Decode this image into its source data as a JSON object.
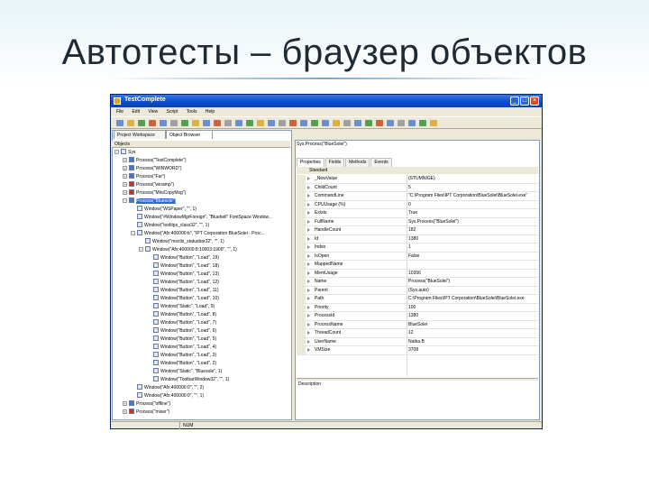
{
  "slide": {
    "title": "Автотесты – браузер объектов"
  },
  "window": {
    "title": "TestComplete",
    "menu": [
      "File",
      "Edit",
      "View",
      "Script",
      "Tools",
      "Help"
    ],
    "left_tabs": [
      "Project Workspace",
      "Object Browser"
    ],
    "objects_header": "Objects",
    "tree": [
      {
        "indent": 0,
        "expander": "−",
        "icon": "gear",
        "label": "Sys"
      },
      {
        "indent": 1,
        "expander": "+",
        "icon": "proc",
        "label": "Process(\"TestComplete\")"
      },
      {
        "indent": 1,
        "expander": "+",
        "icon": "proc",
        "label": "Process(\"WINWORD\")"
      },
      {
        "indent": 1,
        "expander": "+",
        "icon": "proc",
        "label": "Process(\"Far\")"
      },
      {
        "indent": 1,
        "expander": "+",
        "icon": "red",
        "label": "Process(\"winamp\")"
      },
      {
        "indent": 1,
        "expander": "+",
        "icon": "red",
        "label": "Process(\"MiniCopyMsg\")"
      },
      {
        "indent": 1,
        "expander": "−",
        "icon": "proc",
        "label": "Process(\"Bluesole\")",
        "selected": true
      },
      {
        "indent": 2,
        "expander": "",
        "icon": "win",
        "label": "Window(\"WSPaper\", \"\", 1)"
      },
      {
        "indent": 2,
        "expander": "",
        "icon": "win",
        "label": "Window(\"#WindowMgrForeign\", \"Bluebell\" FontSpace Window..."
      },
      {
        "indent": 2,
        "expander": "",
        "icon": "win",
        "label": "Window(\"tooltips_class32\", \"\", 1)"
      },
      {
        "indent": 2,
        "expander": "−",
        "icon": "win",
        "label": "Window(\"Afx:400000:b\", \"IPT Corporation BlueSolei - Proc..."
      },
      {
        "indent": 3,
        "expander": "",
        "icon": "win",
        "label": "Window(\"msctls_statusbar32\", \"\", 1)"
      },
      {
        "indent": 3,
        "expander": "−",
        "icon": "win",
        "label": "Window(\"Afx:400000:8:10003:1900\", \"\", 1)"
      },
      {
        "indent": 4,
        "expander": "",
        "icon": "win",
        "label": "Window(\"Button\", \"Load\", 19)"
      },
      {
        "indent": 4,
        "expander": "",
        "icon": "win",
        "label": "Window(\"Button\", \"Load\", 18)"
      },
      {
        "indent": 4,
        "expander": "",
        "icon": "win",
        "label": "Window(\"Button\", \"Load\", 13)"
      },
      {
        "indent": 4,
        "expander": "",
        "icon": "win",
        "label": "Window(\"Button\", \"Load\", 12)"
      },
      {
        "indent": 4,
        "expander": "",
        "icon": "win",
        "label": "Window(\"Button\", \"Load\", 11)"
      },
      {
        "indent": 4,
        "expander": "",
        "icon": "win",
        "label": "Window(\"Button\", \"Load\", 10)"
      },
      {
        "indent": 4,
        "expander": "",
        "icon": "win",
        "label": "Window(\"Static\", \"Load\", 9)"
      },
      {
        "indent": 4,
        "expander": "",
        "icon": "win",
        "label": "Window(\"Button\", \"Load\", 8)"
      },
      {
        "indent": 4,
        "expander": "",
        "icon": "win",
        "label": "Window(\"Button\", \"Load\", 7)"
      },
      {
        "indent": 4,
        "expander": "",
        "icon": "win",
        "label": "Window(\"Button\", \"Load\", 6)"
      },
      {
        "indent": 4,
        "expander": "",
        "icon": "win",
        "label": "Window(\"Button\", \"Load\", 5)"
      },
      {
        "indent": 4,
        "expander": "",
        "icon": "win",
        "label": "Window(\"Button\", \"Load\", 4)"
      },
      {
        "indent": 4,
        "expander": "",
        "icon": "win",
        "label": "Window(\"Button\", \"Load\", 3)"
      },
      {
        "indent": 4,
        "expander": "",
        "icon": "win",
        "label": "Window(\"Button\", \"Load\", 2)"
      },
      {
        "indent": 4,
        "expander": "",
        "icon": "win",
        "label": "Window(\"Static\", \"Bluesole\", 1)"
      },
      {
        "indent": 4,
        "expander": "",
        "icon": "win",
        "label": "Window(\"ToolbarWindow32\", \"\", 1)"
      },
      {
        "indent": 2,
        "expander": "",
        "icon": "win",
        "label": "Window(\"Afx:400000:0\", \"\", 2)"
      },
      {
        "indent": 2,
        "expander": "",
        "icon": "win",
        "label": "Window(\"Afx:400000:0\", \"\", 1)"
      },
      {
        "indent": 1,
        "expander": "+",
        "icon": "proc",
        "label": "Process(\"offline\")"
      },
      {
        "indent": 1,
        "expander": "+",
        "icon": "red",
        "label": "Process(\"mixer\")"
      }
    ],
    "right": {
      "header": "Sys.Process(\"BlueSolei\")",
      "tabs": [
        "Properties",
        "Fields",
        "Methods",
        "Events"
      ],
      "section": "Standard",
      "rows": [
        {
          "name": "_NewValue",
          "value": "(STUMNIGE)"
        },
        {
          "name": "ChildCount",
          "value": "5"
        },
        {
          "name": "CommandLine",
          "value": "\"C:\\Program Files\\IPT Corporation\\BlueSolei\\BlueSolei.exe\""
        },
        {
          "name": "CPUUsage (%)",
          "value": "0"
        },
        {
          "name": "Exists",
          "value": "True"
        },
        {
          "name": "FullName",
          "value": "Sys.Process(\"BlueSolei\")"
        },
        {
          "name": "HandleCount",
          "value": "182"
        },
        {
          "name": "Id",
          "value": "1380"
        },
        {
          "name": "Index",
          "value": "1"
        },
        {
          "name": "IsOpen",
          "value": "False"
        },
        {
          "name": "MappedName",
          "value": ""
        },
        {
          "name": "MemUsage",
          "value": "10356"
        },
        {
          "name": "Name",
          "value": "Process(\"BlueSolei\")"
        },
        {
          "name": "Parent",
          "value": "(Sys.auto)"
        },
        {
          "name": "Path",
          "value": "C:\\Program Files\\IPT Corporation\\BlueSolei\\BlueSolei.exe"
        },
        {
          "name": "Priority",
          "value": "100"
        },
        {
          "name": "ProcessId",
          "value": "1380"
        },
        {
          "name": "ProcessName",
          "value": "BlueSolei"
        },
        {
          "name": "ThreadCount",
          "value": "12"
        },
        {
          "name": "UserName",
          "value": "Natka.B"
        },
        {
          "name": "VMSize",
          "value": "3708"
        }
      ],
      "description_label": "Description"
    },
    "status": {
      "num": "NUM"
    }
  },
  "colors": {
    "titlebar": "#0a4fcb",
    "selection": "#316ac5",
    "chrome": "#ece9d8"
  }
}
